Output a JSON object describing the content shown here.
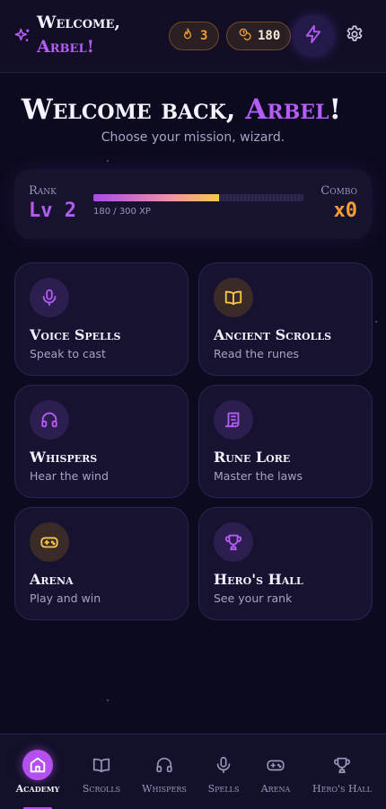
{
  "header": {
    "welcome_line1": "Welcome,",
    "welcome_line2": "Arbel!",
    "streak": "3",
    "gold": "180"
  },
  "hero": {
    "title_prefix": "Welcome back, ",
    "title_name": "Arbel",
    "title_suffix": "!",
    "subtitle": "Choose your mission, wizard."
  },
  "stats": {
    "rank_label": "Rank",
    "rank_value": "Lv 2",
    "xp_text": "180 / 300 XP",
    "xp_current": 180,
    "xp_max": 300,
    "combo_label": "Combo",
    "combo_value": "x0"
  },
  "missions": [
    {
      "title": "Voice Spells",
      "subtitle": "Speak to cast",
      "icon": "microphone-icon"
    },
    {
      "title": "Ancient Scrolls",
      "subtitle": "Read the runes",
      "icon": "book-icon"
    },
    {
      "title": "Whispers",
      "subtitle": "Hear the wind",
      "icon": "headphones-icon"
    },
    {
      "title": "Rune Lore",
      "subtitle": "Master the laws",
      "icon": "scroll-icon"
    },
    {
      "title": "Arena",
      "subtitle": "Play and win",
      "icon": "gamepad-icon"
    },
    {
      "title": "Hero's Hall",
      "subtitle": "See your rank",
      "icon": "trophy-icon"
    }
  ],
  "nav": [
    {
      "label": "Academy",
      "icon": "home-icon",
      "active": true
    },
    {
      "label": "Scrolls",
      "icon": "book-icon"
    },
    {
      "label": "Whispers",
      "icon": "headphones-icon"
    },
    {
      "label": "Spells",
      "icon": "microphone-icon"
    },
    {
      "label": "Arena",
      "icon": "gamepad-icon"
    },
    {
      "label": "Hero's Hall",
      "icon": "trophy-icon"
    }
  ],
  "colors": {
    "accent_purple": "#b45cf5",
    "accent_orange": "#f39c32",
    "accent_gold": "#f7c948",
    "background": "#0c0a1e"
  }
}
